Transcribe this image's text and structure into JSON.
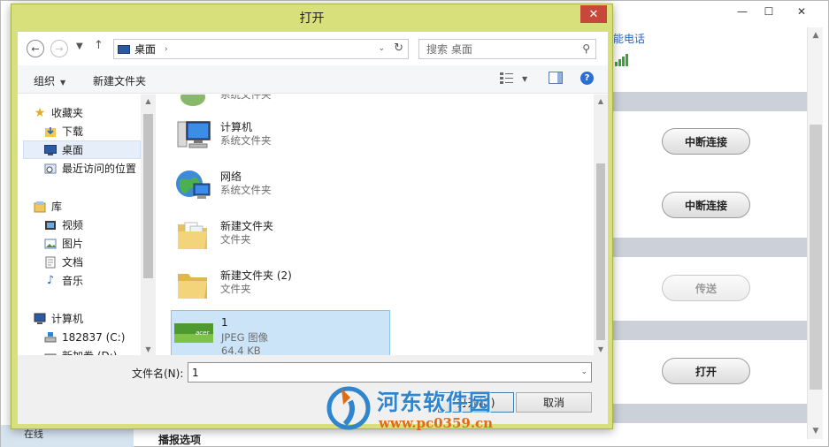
{
  "background_app": {
    "phone_label": "能电话",
    "buttons": {
      "disconnect_1": "中断连接",
      "disconnect_2": "中断连接",
      "send": "传送",
      "open": "打开"
    },
    "bottom_text": "播报选项",
    "left_bottom_text": "在线",
    "window_controls": {
      "minimize": "—",
      "maximize": "☐",
      "close": "✕"
    }
  },
  "dialog": {
    "title": "打开",
    "close_glyph": "✕",
    "address": {
      "location": "桌面",
      "chevron": "›",
      "dropdown": "⌄",
      "refresh": "↻"
    },
    "search": {
      "placeholder": "搜索 桌面"
    },
    "toolbar": {
      "organize": "组织",
      "new_folder": "新建文件夹"
    },
    "nav": {
      "favorites": "收藏夹",
      "downloads": "下载",
      "desktop": "桌面",
      "recent": "最近访问的位置",
      "libraries": "库",
      "videos": "视频",
      "pictures": "图片",
      "documents": "文档",
      "music": "音乐",
      "computer": "计算机",
      "drive_c": "182837 (C:)",
      "drive_d": "新加卷 (D:)"
    },
    "files": [
      {
        "name": "",
        "type": "系统文件夹"
      },
      {
        "name": "计算机",
        "type": "系统文件夹"
      },
      {
        "name": "网络",
        "type": "系统文件夹"
      },
      {
        "name": "新建文件夹",
        "type": "文件夹"
      },
      {
        "name": "新建文件夹 (2)",
        "type": "文件夹"
      },
      {
        "name": "1",
        "type": "JPEG 图像",
        "size": "64.4 KB",
        "thumb_text": "acer"
      }
    ],
    "filename": {
      "label": "文件名(N):",
      "value": "1"
    },
    "buttons": {
      "open": "打开(O)",
      "cancel": "取消"
    }
  },
  "watermark": {
    "text": "河东软件园",
    "url": "www.pc0359.cn"
  },
  "colors": {
    "dialog_frame": "#d8e07c",
    "selection": "#cce4f7",
    "close_red": "#c7473a",
    "watermark_blue": "#2f86cf",
    "watermark_orange": "#e16a12"
  }
}
